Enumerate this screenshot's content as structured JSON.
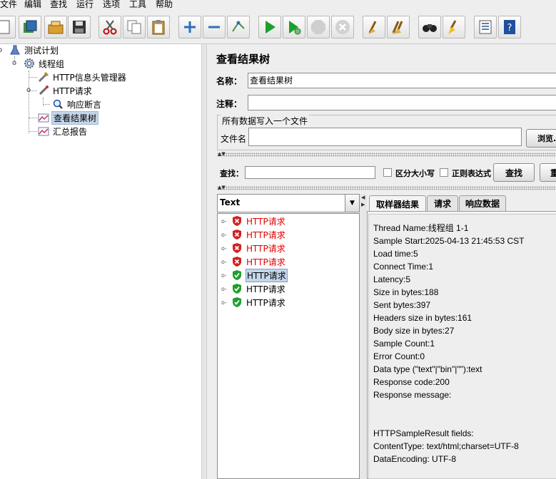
{
  "menu": [
    "文件",
    "编辑",
    "查找",
    "运行",
    "选项",
    "工具",
    "帮助"
  ],
  "toolbar": {
    "buttons": [
      "new-icon",
      "templates-icon",
      "open-icon",
      "save-icon",
      "cut-icon",
      "copy-icon",
      "paste-icon",
      "expand-icon",
      "collapse-icon",
      "toggle-icon",
      "start-icon",
      "start-no-pause-icon",
      "stop-icon",
      "shutdown-icon",
      "clear-icon",
      "clear-all-icon",
      "search-icon",
      "reset-search-icon",
      "function-helper-icon",
      "help-icon"
    ]
  },
  "tree": {
    "items": [
      {
        "label": "测试计划",
        "icon": "test-plan-icon"
      },
      {
        "label": "线程组",
        "icon": "thread-group-icon"
      },
      {
        "label": "HTTP信息头管理器",
        "icon": "header-manager-icon"
      },
      {
        "label": "HTTP请求",
        "icon": "http-sampler-icon"
      },
      {
        "label": "响应断言",
        "icon": "assertion-icon"
      },
      {
        "label": "查看结果树",
        "icon": "listener-icon"
      },
      {
        "label": "汇总报告",
        "icon": "listener-icon"
      }
    ]
  },
  "panel": {
    "title": "查看结果树",
    "name_label": "名称：",
    "name_value": "查看结果树",
    "comment_label": "注释：",
    "comment_value": "",
    "file_group_title": "所有数据写入一个文件",
    "filename_label": "文件名",
    "filename_value": "",
    "browse_label": "浏览...",
    "search_label": "查找：",
    "search_value": "",
    "case_label": "区分大小写",
    "regex_label": "正则表达式",
    "find_button": "查找",
    "reset_button": "重"
  },
  "results": {
    "renderer": "Text",
    "items": [
      {
        "label": "HTTP请求",
        "status": "error"
      },
      {
        "label": "HTTP请求",
        "status": "error"
      },
      {
        "label": "HTTP请求",
        "status": "error"
      },
      {
        "label": "HTTP请求",
        "status": "error"
      },
      {
        "label": "HTTP请求",
        "status": "success"
      },
      {
        "label": "HTTP请求",
        "status": "success"
      },
      {
        "label": "HTTP请求",
        "status": "success"
      }
    ],
    "tabs": [
      "取样器结果",
      "请求",
      "响应数据"
    ],
    "sampler_lines": [
      "Thread Name:线程组 1-1",
      "Sample Start:2025-04-13 21:45:53 CST",
      "Load time:5",
      "Connect Time:1",
      "Latency:5",
      "Size in bytes:188",
      "Sent bytes:397",
      "Headers size in bytes:161",
      "Body size in bytes:27",
      "Sample Count:1",
      "Error Count:0",
      "Data type (\"text\"|\"bin\"|\"\"):text",
      "Response code:200",
      "Response message:",
      "",
      "",
      "HTTPSampleResult fields:",
      "ContentType: text/html;charset=UTF-8",
      "DataEncoding: UTF-8"
    ]
  },
  "colors": {
    "error_text": "#e00000",
    "selection": "#c5d6ea"
  }
}
